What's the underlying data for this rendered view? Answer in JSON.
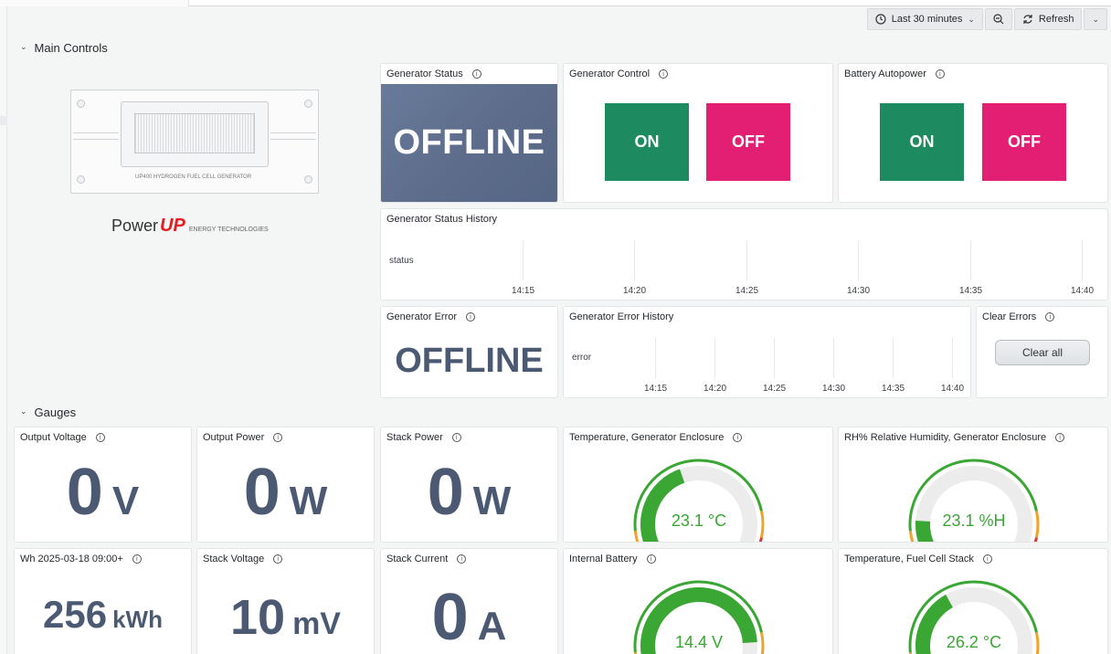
{
  "toolbar": {
    "time_range": "Last 30 minutes",
    "refresh": "Refresh"
  },
  "rows": {
    "main_controls": "Main Controls",
    "gauges": "Gauges"
  },
  "logo": {
    "model": "UP400",
    "model_sub": "HYDROGEN FUEL CELL GENERATOR",
    "brand_power": "Power",
    "brand_up": "UP",
    "brand_tag": "ENERGY TECHNOLOGIES"
  },
  "generator_status": {
    "title": "Generator Status",
    "value": "OFFLINE",
    "bg_color": "#5e6e8c"
  },
  "generator_control": {
    "title": "Generator Control",
    "on": "ON",
    "off": "OFF"
  },
  "battery_autopower": {
    "title": "Battery Autopower",
    "on": "ON",
    "off": "OFF"
  },
  "status_history": {
    "title": "Generator Status History",
    "row_label": "status",
    "ticks": [
      "14:15",
      "14:20",
      "14:25",
      "14:30",
      "14:35",
      "14:40"
    ]
  },
  "generator_error": {
    "title": "Generator Error",
    "value": "OFFLINE"
  },
  "error_history": {
    "title": "Generator Error History",
    "row_label": "error",
    "ticks": [
      "14:15",
      "14:20",
      "14:25",
      "14:30",
      "14:35",
      "14:40"
    ]
  },
  "clear_errors": {
    "title": "Clear Errors",
    "button": "Clear all"
  },
  "stats": [
    {
      "title": "Output Voltage",
      "value": "0",
      "unit": "V"
    },
    {
      "title": "Output Power",
      "value": "0",
      "unit": "W"
    },
    {
      "title": "Stack Power",
      "value": "0",
      "unit": "W"
    },
    {
      "title": "Wh 2025-03-18 09:00+",
      "value": "256",
      "unit": "kWh"
    },
    {
      "title": "Stack Voltage",
      "value": "10",
      "unit": "mV"
    },
    {
      "title": "Stack Current",
      "value": "0",
      "unit": "A"
    }
  ],
  "gauges": [
    {
      "title": "Temperature, Generator Enclosure",
      "value": "23.1 °C",
      "fraction": 0.42
    },
    {
      "title": "RH% Relative Humidity, Generator Enclosure",
      "value": "23.1 %H",
      "fraction": 0.14
    },
    {
      "title": "Internal Battery",
      "value": "14.4 V",
      "fraction": 0.86
    },
    {
      "title": "Temperature, Fuel Cell Stack",
      "value": "26.2 °C",
      "fraction": 0.38
    }
  ],
  "colors": {
    "on": "#1e8a5f",
    "off": "#e21f72",
    "gauge_value": "#3aa634",
    "stat_text": "#4b5a72"
  }
}
